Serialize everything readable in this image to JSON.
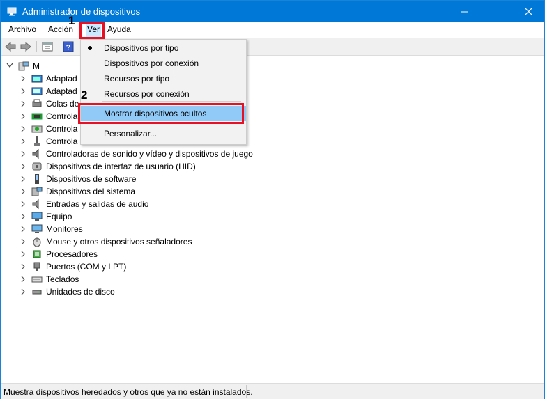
{
  "window": {
    "title": "Administrador de dispositivos",
    "controls": {
      "minimize": "–",
      "maximize": "☐",
      "close": "✕"
    }
  },
  "menubar": [
    "Archivo",
    "Acción",
    "Ver",
    "Ayuda"
  ],
  "toolbar": {
    "icons": [
      "back-arrow-icon",
      "forward-arrow-icon",
      "properties-icon",
      "help-icon"
    ]
  },
  "tree": {
    "root_label": "M",
    "items": [
      "Adaptad",
      "Adaptad",
      "Colas de",
      "Controla",
      "Controla",
      "Controla",
      "Controladoras de sonido y vídeo y dispositivos de juego",
      "Dispositivos de interfaz de usuario (HID)",
      "Dispositivos de software",
      "Dispositivos del sistema",
      "Entradas y salidas de audio",
      "Equipo",
      "Monitores",
      "Mouse y otros dispositivos señaladores",
      "Procesadores",
      "Puertos (COM y LPT)",
      "Teclados",
      "Unidades de disco"
    ]
  },
  "dropdown": {
    "items": [
      "Dispositivos por tipo",
      "Dispositivos por conexión",
      "Recursos por tipo",
      "Recursos por conexión",
      "Mostrar dispositivos ocultos",
      "Personalizar..."
    ],
    "checked_item": "Dispositivos por tipo",
    "highlighted_item": "Mostrar dispositivos ocultos"
  },
  "annotations": {
    "step1": "1",
    "step2": "2",
    "color": "#e81123"
  },
  "statusbar": {
    "text": "Muestra dispositivos heredados y otros que ya no están instalados."
  },
  "colors": {
    "titlebar": "#0078d7",
    "highlight": "#91c9f7"
  }
}
